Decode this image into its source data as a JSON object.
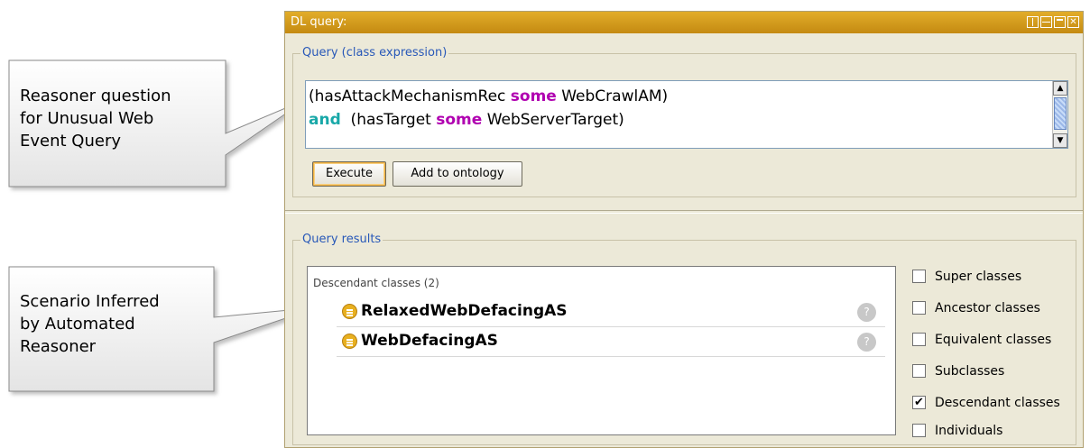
{
  "callouts": [
    {
      "text_lines": [
        "Reasoner question",
        "for Unusual Web",
        "Event Query"
      ]
    },
    {
      "text_lines": [
        "Scenario Inferred",
        "by Automated",
        "Reasoner"
      ]
    }
  ],
  "window": {
    "title": "DL query:",
    "controls": [
      "split-columns-icon",
      "split-rows-icon",
      "maximize-icon",
      "close-icon"
    ]
  },
  "query": {
    "legend": "Query (class expression)",
    "line1": {
      "open": "(hasAttackMechanismRec ",
      "kw": "some",
      "close": " WebCrawlAM)"
    },
    "line2": {
      "and_kw": "and",
      "open": "  (hasTarget ",
      "kw": "some",
      "close": " WebServerTarget)"
    },
    "execute_label": "Execute",
    "add_label": "Add to ontology"
  },
  "results": {
    "legend": "Query results",
    "section_heading": "Descendant classes (2)",
    "items": [
      {
        "label": "RelaxedWebDefacingAS",
        "explain": "?"
      },
      {
        "label": "WebDefacingAS",
        "explain": "?"
      }
    ],
    "options": [
      {
        "label": "Super classes",
        "checked": false
      },
      {
        "label": "Ancestor classes",
        "checked": false
      },
      {
        "label": "Equivalent classes",
        "checked": false
      },
      {
        "label": "Subclasses",
        "checked": false
      },
      {
        "label": "Descendant classes",
        "checked": true
      },
      {
        "label": "Individuals",
        "checked": false
      }
    ]
  },
  "colors": {
    "title_bar": "#d79e1e",
    "keyword_some": "#b000b0",
    "keyword_and": "#18a8a8",
    "legend_text": "#2858b8"
  }
}
